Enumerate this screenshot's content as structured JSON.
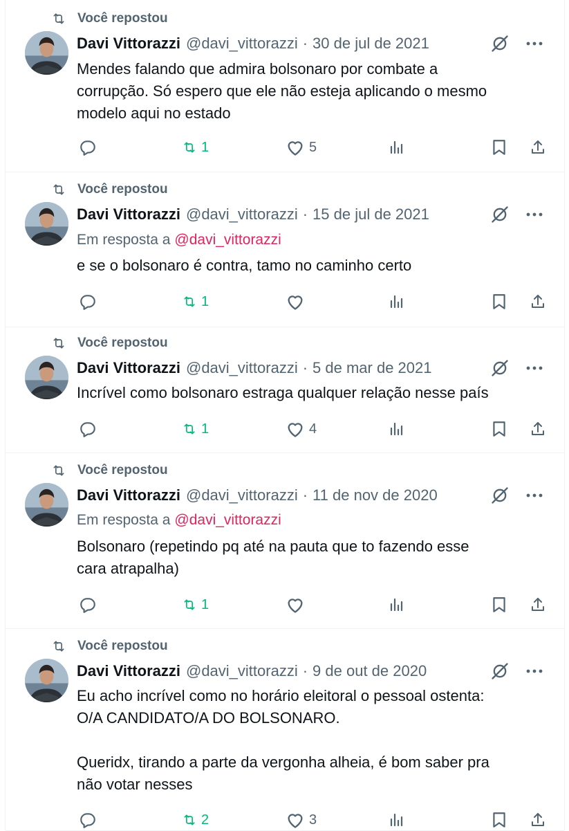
{
  "repost_label": "Você repostou",
  "author": {
    "name": "Davi Vittorazzi",
    "handle": "@davi_vittorazzi"
  },
  "separator": "·",
  "reply_prefix": "Em resposta a",
  "colors": {
    "text": "#0f1419",
    "secondary": "#536471",
    "retweet_active": "#00ba7c",
    "mention": "#e0245e",
    "divider": "#eff3f4"
  },
  "icons": {
    "repost": "repost-icon",
    "grok": "grok-icon",
    "more": "more-icon",
    "reply": "reply-icon",
    "like": "like-icon",
    "views": "views-icon",
    "bookmark": "bookmark-icon",
    "share": "share-icon"
  },
  "tweets": [
    {
      "date": "30 de jul de 2021",
      "reply_to": "",
      "text": "Mendes falando que admira bolsonaro por combate a\ncorrupção. Só espero que ele não esteja aplicando o mesmo\nmodelo aqui no estado",
      "retweets": "1",
      "likes": "5"
    },
    {
      "date": "15 de jul de 2021",
      "reply_to": "@davi_vittorazzi",
      "text": "e se o bolsonaro é contra, tamo no caminho certo",
      "retweets": "1",
      "likes": ""
    },
    {
      "date": "5 de mar de 2021",
      "reply_to": "",
      "text": "Incrível como bolsonaro estraga qualquer relação nesse país",
      "retweets": "1",
      "likes": "4"
    },
    {
      "date": "11 de nov de 2020",
      "reply_to": "@davi_vittorazzi",
      "text": "Bolsonaro (repetindo pq até na pauta que to fazendo esse\ncara atrapalha)",
      "retweets": "1",
      "likes": ""
    },
    {
      "date": "9 de out de 2020",
      "reply_to": "",
      "text": "Eu acho incrível como no horário eleitoral o pessoal ostenta:\nO/A CANDIDATO/A DO BOLSONARO.\n\nQueridx, tirando a parte da vergonha alheia, é bom saber pra\nnão votar nesses",
      "retweets": "2",
      "likes": "3"
    }
  ]
}
